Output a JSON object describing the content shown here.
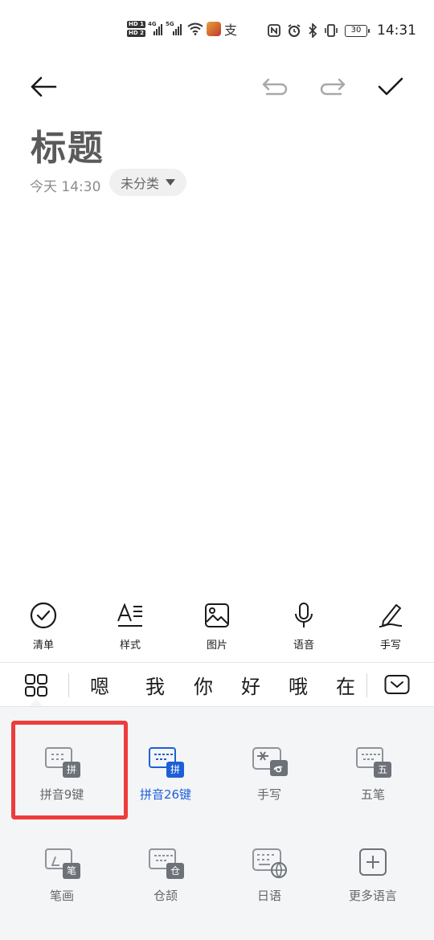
{
  "status_bar": {
    "hd1": "HD 1",
    "hd2": "HD 2",
    "net1": "4G",
    "net2": "5G",
    "pay_glyph": "支",
    "battery": "30",
    "time": "14:31"
  },
  "note": {
    "title": "标题",
    "time": "今天 14:30",
    "category": "未分类"
  },
  "edit_tools": [
    {
      "label": "清单",
      "icon": "checklist-icon"
    },
    {
      "label": "样式",
      "icon": "text-style-icon"
    },
    {
      "label": "图片",
      "icon": "image-icon"
    },
    {
      "label": "语音",
      "icon": "microphone-icon"
    },
    {
      "label": "手写",
      "icon": "handwriting-pen-icon"
    }
  ],
  "candidates": [
    "嗯",
    "我",
    "你",
    "好",
    "哦",
    "在"
  ],
  "input_methods": [
    {
      "label": "拼音9键",
      "tag": "拼",
      "active": false
    },
    {
      "label": "拼音26键",
      "tag": "拼",
      "active": true
    },
    {
      "label": "手写",
      "tag": "",
      "active": false
    },
    {
      "label": "五笔",
      "tag": "五",
      "active": false
    },
    {
      "label": "笔画",
      "tag": "笔",
      "active": false
    },
    {
      "label": "仓颉",
      "tag": "仓",
      "active": false
    },
    {
      "label": "日语",
      "tag": "",
      "active": false
    },
    {
      "label": "更多语言",
      "tag": "",
      "active": false
    }
  ],
  "colors": {
    "accent": "#1f5fd6",
    "highlight": "#ee3b3b",
    "panel_bg": "#f4f5f7"
  }
}
